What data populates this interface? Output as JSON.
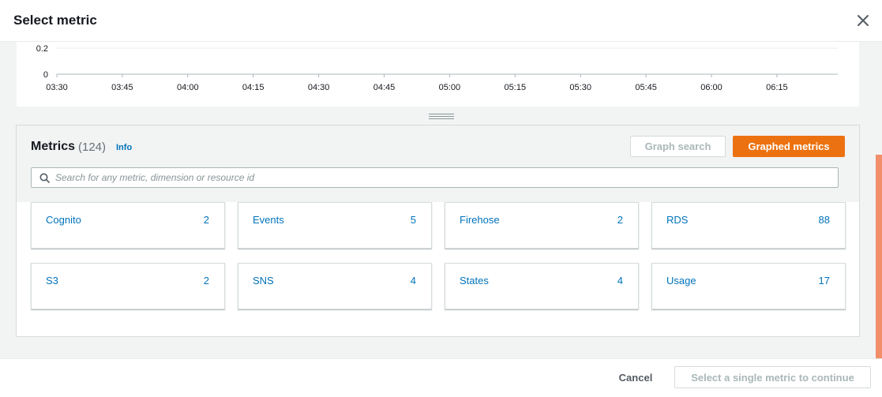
{
  "modal": {
    "title": "Select metric"
  },
  "graph": {
    "y_ticks": [
      "0.2",
      "0"
    ],
    "x_ticks": [
      "03:30",
      "03:45",
      "04:00",
      "04:15",
      "04:30",
      "04:45",
      "05:00",
      "05:15",
      "05:30",
      "05:45",
      "06:00",
      "06:15"
    ]
  },
  "metrics": {
    "heading": "Metrics",
    "count": "(124)",
    "info_label": "Info",
    "graph_search_label": "Graph search",
    "graphed_metrics_label": "Graphed metrics",
    "search_placeholder": "Search for any metric, dimension or resource id",
    "search_value": "",
    "namespaces": [
      {
        "name": "Cognito",
        "count": "2"
      },
      {
        "name": "Events",
        "count": "5"
      },
      {
        "name": "Firehose",
        "count": "2"
      },
      {
        "name": "RDS",
        "count": "88"
      },
      {
        "name": "S3",
        "count": "2"
      },
      {
        "name": "SNS",
        "count": "4"
      },
      {
        "name": "States",
        "count": "4"
      },
      {
        "name": "Usage",
        "count": "17"
      }
    ]
  },
  "footer": {
    "cancel_label": "Cancel",
    "continue_label": "Select a single metric to continue"
  },
  "colors": {
    "primary_button": "#ec7211",
    "link": "#0073bb",
    "scroll_thumb": "#f28e6a"
  }
}
